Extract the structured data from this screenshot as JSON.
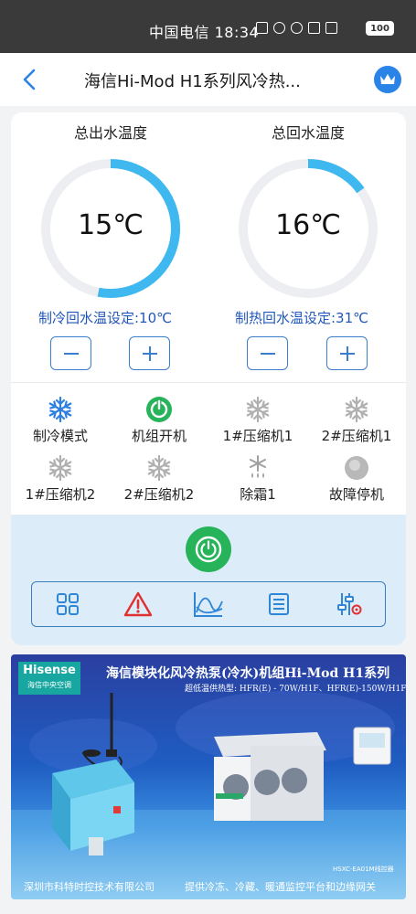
{
  "status_bar": {
    "carrier_time": "中国电信 18:34",
    "battery": "100"
  },
  "nav": {
    "title": "海信Hi-Mod H1系列风冷热..."
  },
  "gauges": [
    {
      "title": "总出水温度",
      "value": "15℃",
      "fill_fraction": 0.53,
      "color": "#3fb8ef"
    },
    {
      "title": "总回水温度",
      "value": "16℃",
      "fill_fraction": 0.15,
      "color": "#3fb8ef"
    }
  ],
  "setpoints": {
    "cooling": "制冷回水温设定:10℃",
    "heating": "制热回水温设定:31℃"
  },
  "status_items": [
    {
      "label": "制冷模式",
      "icon": "snowflake-icon",
      "color": "#2f7fe0"
    },
    {
      "label": "机组开机",
      "icon": "power-on-icon",
      "color": "#27b35a"
    },
    {
      "label": "1#压缩机1",
      "icon": "snowflake-icon",
      "color": "#b0b0b0"
    },
    {
      "label": "2#压缩机1",
      "icon": "snowflake-icon",
      "color": "#b0b0b0"
    },
    {
      "label": "1#压缩机2",
      "icon": "snowflake-icon",
      "color": "#b0b0b0"
    },
    {
      "label": "2#压缩机2",
      "icon": "snowflake-icon",
      "color": "#b0b0b0"
    },
    {
      "label": "除霜1",
      "icon": "defrost-icon",
      "color": "#a0a0a0"
    },
    {
      "label": "故障停机",
      "icon": "fault-indicator-icon",
      "color": "#b8b8b8"
    }
  ],
  "toolbar": [
    "grid-icon",
    "alarm-icon",
    "trend-chart-icon",
    "list-icon",
    "settings-sliders-icon"
  ],
  "banner": {
    "logo_brand": "Hisense",
    "logo_sub": "海信中央空调",
    "title": "海信模块化风冷热泵(冷水)机组Hi-Mod H1系列",
    "subtitle": "超低温供热型: HFR(E) - 70W/H1F、HFR(E)-150W/H1F",
    "controller_model": "HSXC-EA01M线控器",
    "footer_left": "深圳市科特时控技术有限公司",
    "footer_right": "提供冷冻、冷藏、暖通监控平台和边缘网关"
  },
  "colors": {
    "accent_blue": "#2a83e6",
    "power_green": "#27b35a",
    "alarm_red": "#e03030",
    "control_bg": "#dcecf8"
  }
}
